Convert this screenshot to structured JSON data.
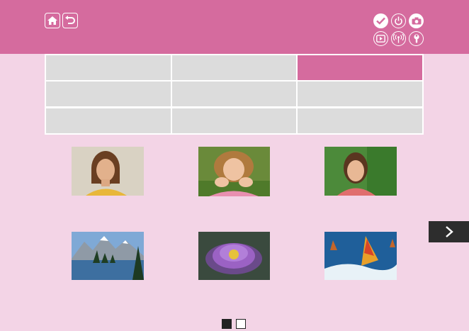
{
  "header": {
    "nav": [
      {
        "name": "home",
        "icon": "home-icon"
      },
      {
        "name": "back",
        "icon": "back-arrow-icon"
      }
    ],
    "mode_icons": [
      {
        "name": "check",
        "icon": "checkmark-icon",
        "state": "filled"
      },
      {
        "name": "power",
        "icon": "power-icon",
        "state": "outline"
      },
      {
        "name": "camera",
        "icon": "camera-icon",
        "state": "active"
      },
      {
        "name": "playback",
        "icon": "playback-icon",
        "state": "outline"
      },
      {
        "name": "wireless",
        "icon": "wireless-icon",
        "state": "outline"
      },
      {
        "name": "settings",
        "icon": "wrench-icon",
        "state": "outline"
      }
    ]
  },
  "tab_grid": {
    "rows": 3,
    "columns": 3,
    "active_cell": [
      0,
      2
    ]
  },
  "thumbnails": [
    {
      "subject": "woman-portrait"
    },
    {
      "subject": "smiling-girl-on-grass"
    },
    {
      "subject": "woman-outdoors-greenery"
    },
    {
      "subject": "mountain-lake-landscape"
    },
    {
      "subject": "purple-water-lily"
    },
    {
      "subject": "windsurfer-on-wave"
    }
  ],
  "pager": {
    "total_pages": 2,
    "current_page": 1,
    "next_icon": "chevron-right-icon"
  },
  "colors": {
    "header": "#d56b9e",
    "background": "#f3d4e6",
    "cell": "#dcdcdc",
    "active_cell": "#d56b9e",
    "next_button": "#2d2d2d"
  }
}
